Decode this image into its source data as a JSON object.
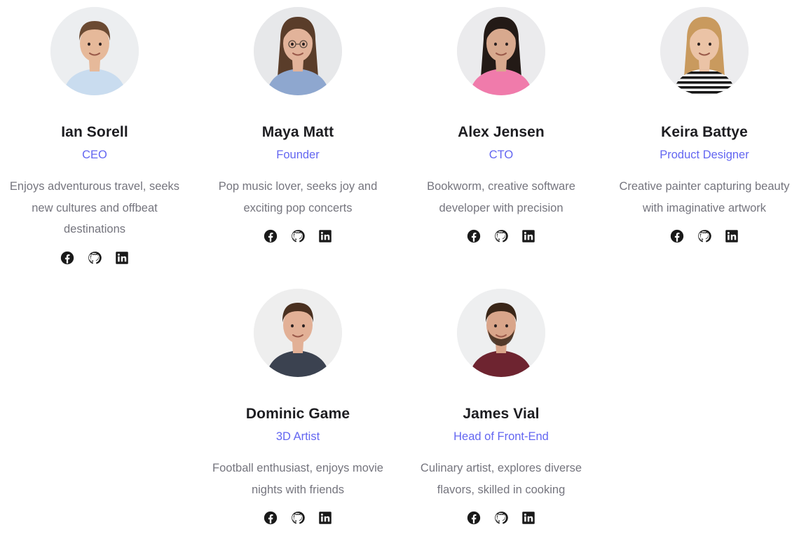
{
  "team": [
    {
      "name": "Ian Sorell",
      "role": "CEO",
      "bio": "Enjoys adventurous travel, seeks new cultures and offbeat destinations",
      "avatar": {
        "bg": "#eceef0",
        "skin": "#e6b99a",
        "hair": "#6b4a32",
        "shirt": "#c9dcef",
        "accent": "#a9c3dd"
      }
    },
    {
      "name": "Maya Matt",
      "role": "Founder",
      "bio": "Pop music lover, seeks joy and exciting pop concerts",
      "avatar": {
        "bg": "#e7e8ea",
        "skin": "#e2b39a",
        "hair": "#5a3d2a",
        "shirt": "#8ea7cf",
        "accent": "#6f8bbf"
      }
    },
    {
      "name": "Alex Jensen",
      "role": "CTO",
      "bio": "Bookworm, creative software developer with precision",
      "avatar": {
        "bg": "#ebebed",
        "skin": "#d8a98e",
        "hair": "#231a16",
        "shirt": "#f07bab",
        "accent": "#e4669a"
      }
    },
    {
      "name": "Keira Battye",
      "role": "Product Designer",
      "bio": "Creative painter capturing beauty with imaginative artwork",
      "avatar": {
        "bg": "#ececee",
        "skin": "#ebc3a6",
        "hair": "#c99a5e",
        "shirt": "#f4f4f4",
        "accent": "#151515"
      }
    },
    {
      "name": "Dominic Game",
      "role": "3D Artist",
      "bio": "Football enthusiast, enjoys movie nights with friends",
      "avatar": {
        "bg": "#eeeeee",
        "skin": "#e2b096",
        "hair": "#4a3020",
        "shirt": "#3b4250",
        "accent": "#2e3440"
      }
    },
    {
      "name": "James Vial",
      "role": "Head of Front-End",
      "bio": "Culinary artist, explores diverse flavors, skilled in cooking",
      "avatar": {
        "bg": "#eeeff0",
        "skin": "#d9a58a",
        "hair": "#3a2618",
        "shirt": "#6e2430",
        "accent": "#581b25"
      }
    }
  ],
  "social_icons": [
    "facebook-icon",
    "github-icon",
    "linkedin-icon"
  ],
  "colors": {
    "accent": "#6366f1",
    "name": "#1d1d21",
    "bio": "#75757e",
    "icon": "#1a1a1a"
  }
}
